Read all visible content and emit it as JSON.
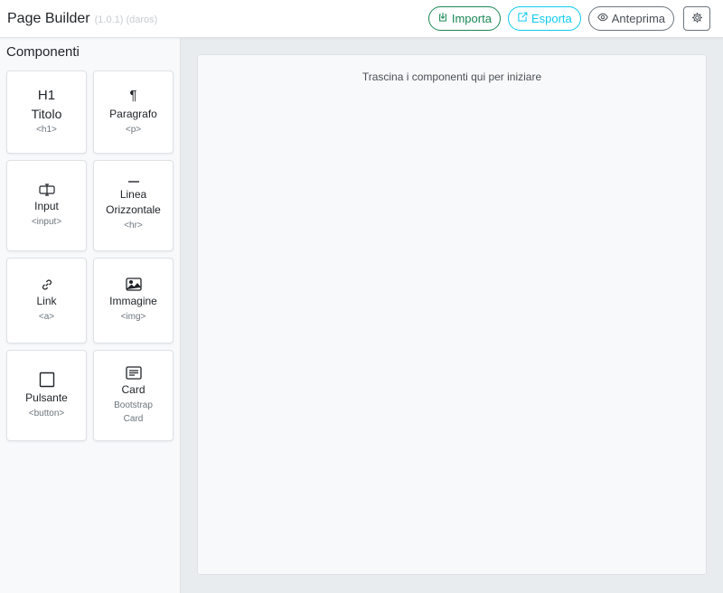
{
  "header": {
    "title": "Page Builder",
    "version": "(1.0.1) (daros)",
    "buttons": {
      "import": "Importa",
      "export": "Esporta",
      "preview": "Anteprima"
    }
  },
  "sidebar": {
    "title": "Componenti",
    "components": [
      {
        "icon": "heading-icon",
        "icon_text": "H1",
        "label": "Titolo",
        "tag": "<h1>"
      },
      {
        "icon": "paragraph-icon",
        "icon_text": "¶",
        "label": "Paragrafo",
        "tag": "<p>"
      },
      {
        "icon": "input-cursor-icon",
        "label": "Input",
        "tag": "<input>"
      },
      {
        "icon": "dash-icon",
        "label": "Linea Orizzontale",
        "tag": "<hr>"
      },
      {
        "icon": "link-icon",
        "label": "Link",
        "tag": "<a>"
      },
      {
        "icon": "image-icon",
        "label": "Immagine",
        "tag": "<img>"
      },
      {
        "icon": "square-icon",
        "label": "Pulsante",
        "tag": "<button>"
      },
      {
        "icon": "card-text-icon",
        "label": "Card",
        "tag": "Bootstrap Card"
      }
    ]
  },
  "canvas": {
    "hint": "Trascina i componenti qui per iniziare"
  },
  "colors": {
    "success": "#198754",
    "info": "#0dcaf0",
    "secondary": "#6c757d",
    "workspace_bg": "#e9ecef"
  }
}
